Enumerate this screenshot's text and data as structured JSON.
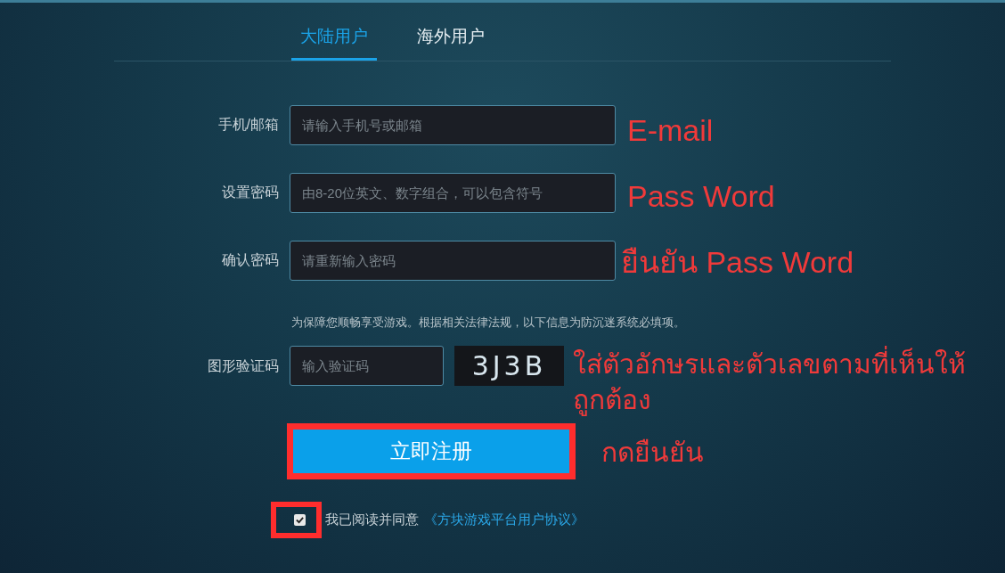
{
  "tabs": [
    {
      "label": "大陆用户",
      "selected": true
    },
    {
      "label": "海外用户",
      "selected": false
    }
  ],
  "fields": [
    {
      "label": "手机/邮箱",
      "placeholder": "请输入手机号或邮箱"
    },
    {
      "label": "设置密码",
      "placeholder": "由8-20位英文、数字组合，可以包含符号"
    },
    {
      "label": "确认密码",
      "placeholder": "请重新输入密码"
    }
  ],
  "notice": "为保障您顺畅享受游戏。根据相关法律法规，以下信息为防沉迷系统必填项。",
  "captcha": {
    "label": "图形验证码",
    "placeholder": "输入验证码",
    "code": "3J3B"
  },
  "submit_button": "立即注册",
  "agreement": {
    "checked": true,
    "text": "我已阅读并同意",
    "link": "《方块游戏平台用户协议》"
  },
  "annotations": [
    "E-mail",
    "Pass Word",
    "ยืนยัน Pass Word",
    "ใส่ตัวอักษรและตัวเลขตามที่เห็นให้ถูกต้อง",
    "กดยืนยัน"
  ]
}
